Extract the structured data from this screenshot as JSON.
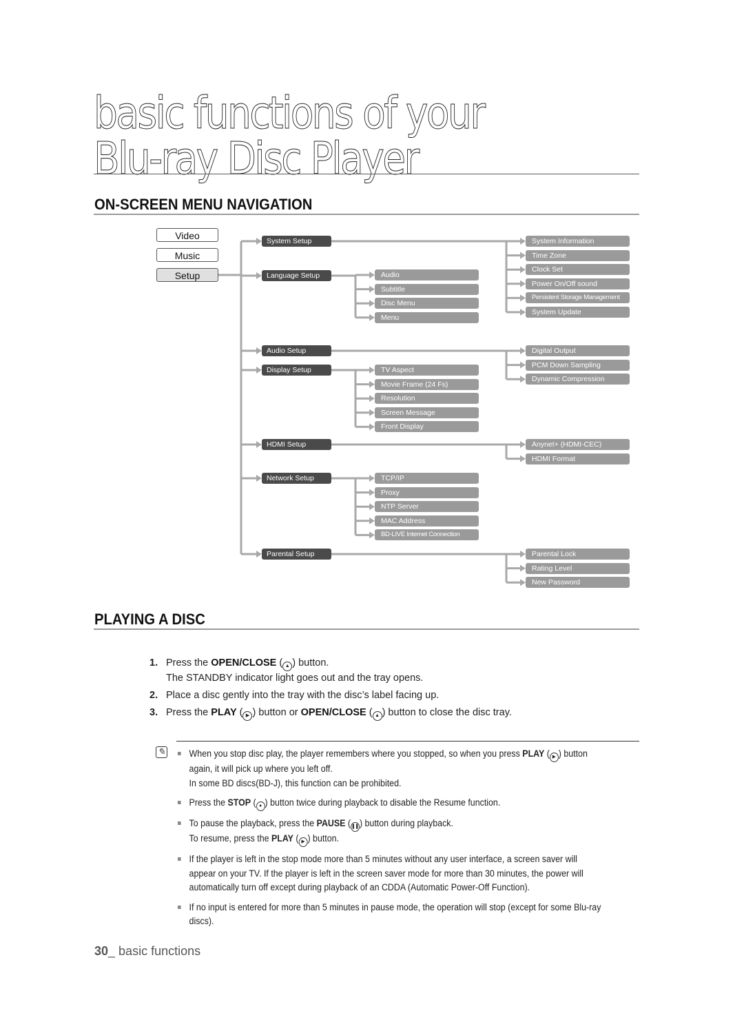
{
  "page": {
    "title_line1": "basic functions of your",
    "title_line2": "Blu-ray Disc Player"
  },
  "section_menu": {
    "heading": "ON-SCREEN MENU NAVIGATION",
    "top_menu": [
      "Video",
      "Music",
      "Setup"
    ],
    "selected_top": "Setup",
    "tree": [
      {
        "label": "System Setup",
        "children": [
          "System Information",
          "Time Zone",
          "Clock Set",
          "Power On/Off sound",
          "Persistent Storage Management",
          "System Update"
        ]
      },
      {
        "label": "Language Setup",
        "children": [
          "Audio",
          "Subtitle",
          "Disc Menu",
          "Menu"
        ]
      },
      {
        "label": "Audio Setup",
        "children": [
          "Digital Output",
          "PCM Down Sampling",
          "Dynamic Compression"
        ]
      },
      {
        "label": "Display Setup",
        "children": [
          "TV Aspect",
          "Movie Frame (24 Fs)",
          "Resolution",
          "Screen Message",
          "Front Display"
        ]
      },
      {
        "label": "HDMI Setup",
        "children": [
          "Anynet+ (HDMI-CEC)",
          "HDMI Format"
        ]
      },
      {
        "label": "Network Setup",
        "children": [
          "TCP/IP",
          "Proxy",
          "NTP Server",
          "MAC Address",
          "BD-LIVE Internet Connection"
        ]
      },
      {
        "label": "Parental Setup",
        "children": [
          "Parental Lock",
          "Rating Level",
          "New Password"
        ]
      }
    ]
  },
  "section_play": {
    "heading": "PLAYING A DISC",
    "steps": [
      {
        "num": "1.",
        "pre": "Press the ",
        "bold": "OPEN/CLOSE",
        "icon": "eject-icon",
        "post": " button.",
        "sub": "The STANDBY indicator light goes out and the tray opens."
      },
      {
        "num": "2.",
        "text": "Place a disc gently into the tray with the disc’s label facing up."
      },
      {
        "num": "3.",
        "pre": "Press the ",
        "bold": "PLAY",
        "icon": "play-icon",
        "mid": " button or ",
        "bold2": "OPEN/CLOSE",
        "icon2": "eject-icon",
        "post": " button to close the disc tray."
      }
    ],
    "notes": [
      {
        "pre": "When you stop disc play, the player remembers where you stopped, so when you press ",
        "bold": "PLAY",
        "post": " button again, it will pick up where you left off.",
        "sub": "In some BD discs(BD-J), this function can be prohibited."
      },
      {
        "pre": "Press the ",
        "bold": "STOP",
        "post": " button twice during playback to disable the Resume function."
      },
      {
        "pre": "To pause the playback, press the ",
        "bold": "PAUSE",
        "post": " button during playback.",
        "sub_pre": "To resume, press the ",
        "sub_bold": "PLAY",
        "sub_post": " button."
      },
      {
        "text": "If the player is left in the stop mode more than 5 minutes without any user interface, a screen saver will appear on your TV. If the player is left in the screen saver mode for more than 30 minutes, the power will automatically turn off except during playback of an CDDA (Automatic Power-Off Function)."
      },
      {
        "text": "If no input is entered for more than 5 minutes in pause mode, the operation will stop (except for some Blu-ray discs)."
      }
    ]
  },
  "footer": {
    "page_number": "30",
    "label": "_ basic functions"
  }
}
